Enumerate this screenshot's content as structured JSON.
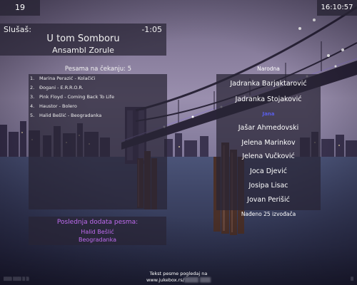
{
  "top_bar": {
    "volume": "19",
    "clock": "16:10:57"
  },
  "now_playing": {
    "label": "Slušaš:",
    "remaining": "-1:05",
    "title": "U tom Somboru",
    "artist": "Ansambl Zorule"
  },
  "queue": {
    "heading": "Pesama na čekanju: 5",
    "items": [
      {
        "num": "1.",
        "text": "Marina Perazić - Kolačići"
      },
      {
        "num": "2.",
        "text": "Đogani - E.R.R.O.R."
      },
      {
        "num": "3.",
        "text": "Pink Floyd - Coming Back To Life"
      },
      {
        "num": "4.",
        "text": "Haustor - Bolero"
      },
      {
        "num": "5.",
        "text": "Halid Bešlić - Beogradanka"
      }
    ]
  },
  "last_added": {
    "heading": "Poslednja dodata pesma:",
    "artist": "Halid Bešlić",
    "title": "Beogradanka"
  },
  "artist_browser": {
    "genre": "Narodna",
    "items": [
      "Jadranka Barjaktarović",
      "Jadranka Stojaković",
      "Jana",
      "Jašar Ahmedovski",
      "Jelena Marinkov",
      "Jelena Vučković",
      "Joca Djević",
      "Josipa Lisac",
      "Jovan Perišić"
    ],
    "found": "Nađeno 25 izvođača"
  },
  "footer": {
    "line1": "Tekst pesme pogledaj na",
    "line2": "www.jukebox.rs/"
  },
  "colors": {
    "accent_purple": "#c06cf0",
    "selected_blue": "#5a5ee8"
  }
}
